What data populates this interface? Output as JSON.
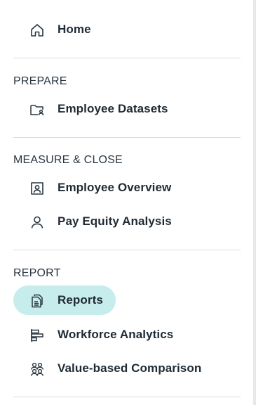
{
  "nav": {
    "home": {
      "label": "Home",
      "icon": "home-icon"
    },
    "sections": [
      {
        "title": "PREPARE",
        "items": [
          {
            "label": "Employee Datasets",
            "icon": "folder-user-icon"
          }
        ]
      },
      {
        "title": "MEASURE & CLOSE",
        "items": [
          {
            "label": "Employee Overview",
            "icon": "id-card-icon"
          },
          {
            "label": "Pay Equity Analysis",
            "icon": "user-icon"
          }
        ]
      },
      {
        "title": "REPORT",
        "items": [
          {
            "label": "Reports",
            "icon": "documents-icon",
            "active": true
          },
          {
            "label": "Workforce Analytics",
            "icon": "bar-chart-icon"
          },
          {
            "label": "Value-based Comparison",
            "icon": "users-group-icon"
          }
        ]
      }
    ]
  },
  "colors": {
    "active_bg": "#c7ecec",
    "text": "#1f2a33",
    "divider": "#d9dcdf"
  }
}
